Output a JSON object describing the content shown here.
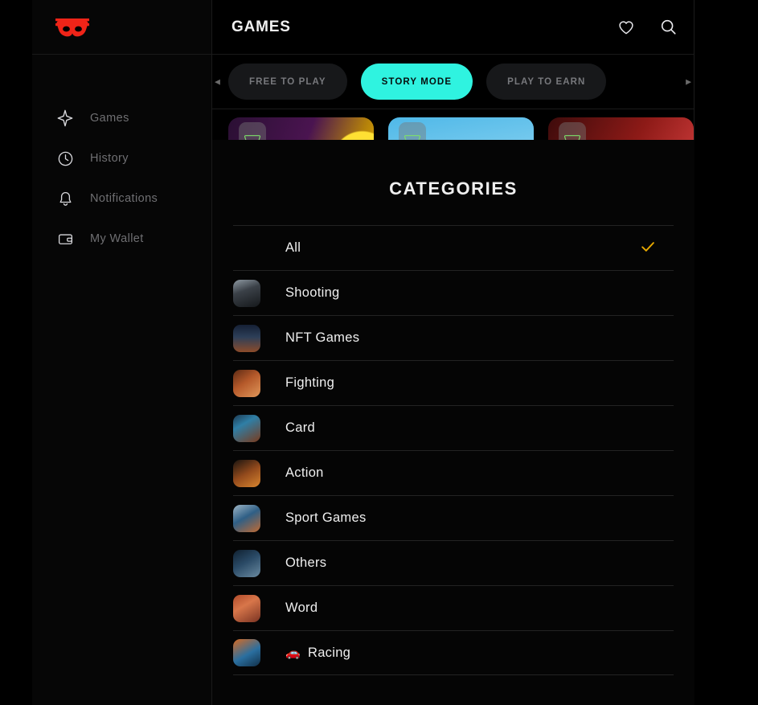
{
  "sidebar": {
    "logo_name": "mask-logo",
    "logo_color": "#ef2418",
    "items": [
      {
        "label": "Games",
        "icon": "sparkle-icon"
      },
      {
        "label": "History",
        "icon": "clock-icon"
      },
      {
        "label": "Notifications",
        "icon": "bell-icon"
      },
      {
        "label": "My Wallet",
        "icon": "wallet-icon"
      }
    ]
  },
  "topbar": {
    "title": "GAMES",
    "favorites_icon": "heart-icon",
    "search_icon": "search-icon"
  },
  "filters": {
    "scroll_left": "◀",
    "scroll_right": "▶",
    "pills": [
      {
        "label": "FREE TO PLAY",
        "active": false
      },
      {
        "label": "STORY MODE",
        "active": true
      },
      {
        "label": "PLAY TO EARN",
        "active": false
      }
    ],
    "active_color": "#2ff3e0"
  },
  "cards": [
    {
      "badge_icon": "mask-badge-icon"
    },
    {
      "badge_icon": "mask-badge-icon"
    },
    {
      "badge_icon": "mask-badge-icon"
    }
  ],
  "modal": {
    "title": "CATEGORIES",
    "check_color": "#e8a900",
    "categories": [
      {
        "label": "All",
        "emoji": "",
        "has_thumb": false,
        "selected": true
      },
      {
        "label": "Shooting",
        "emoji": "",
        "has_thumb": true,
        "selected": false
      },
      {
        "label": "NFT Games",
        "emoji": "",
        "has_thumb": true,
        "selected": false
      },
      {
        "label": "Fighting",
        "emoji": "",
        "has_thumb": true,
        "selected": false
      },
      {
        "label": "Card",
        "emoji": "",
        "has_thumb": true,
        "selected": false
      },
      {
        "label": "Action",
        "emoji": "",
        "has_thumb": true,
        "selected": false
      },
      {
        "label": "Sport Games",
        "emoji": "",
        "has_thumb": true,
        "selected": false
      },
      {
        "label": "Others",
        "emoji": "",
        "has_thumb": true,
        "selected": false
      },
      {
        "label": "Word",
        "emoji": "",
        "has_thumb": true,
        "selected": false
      },
      {
        "label": "Racing",
        "emoji": "🚗",
        "has_thumb": true,
        "selected": false
      }
    ]
  }
}
